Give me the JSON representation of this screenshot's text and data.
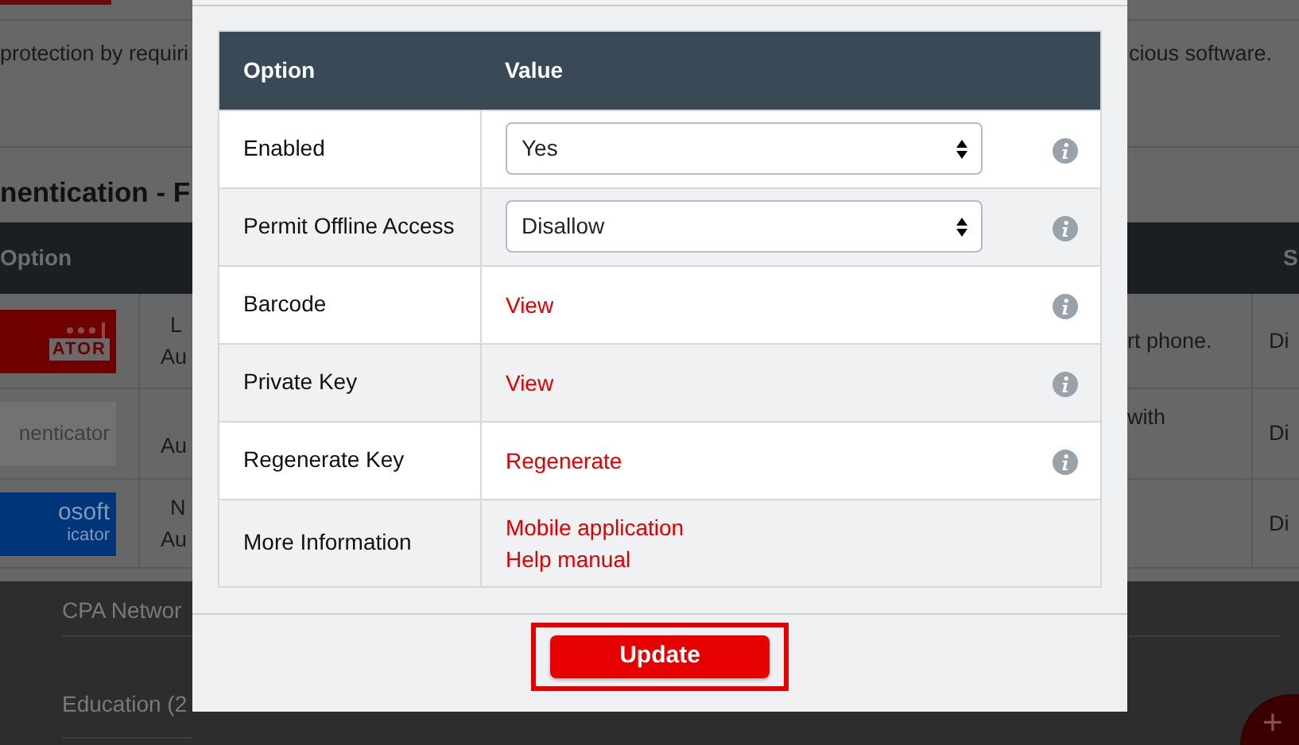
{
  "background": {
    "intro_left": "protection by requiri",
    "intro_right": "cious software.",
    "heading": "nentication - F",
    "table": {
      "columns": [
        "Option",
        "S"
      ],
      "rows": [
        {
          "color": "#6e0000",
          "logo_text": [
            "ATOR"
          ],
          "column_2": [
            "L",
            "Au"
          ],
          "column_4": [
            "rt phone."
          ],
          "column_5": "Di"
        },
        {
          "color": "#727272",
          "logo_text": [
            "nenticator"
          ],
          "column_2": [
            "Au"
          ],
          "column_4": [
            "with"
          ],
          "column_5": "Di"
        },
        {
          "color": "#00357a",
          "logo_text": [
            "osoft",
            "icator"
          ],
          "column_2": [
            "N",
            "Au"
          ],
          "column_4": [],
          "column_5": "Di"
        }
      ]
    },
    "categories": [
      "CPA Networ",
      "Education (2"
    ],
    "add_button": "+"
  },
  "modal": {
    "table": {
      "columns": [
        "Option",
        "Value"
      ],
      "rows": [
        {
          "option": "Enabled",
          "kind": "select",
          "value": "Yes",
          "info": true
        },
        {
          "option": "Permit Offline Access",
          "kind": "select",
          "value": "Disallow",
          "info": true
        },
        {
          "option": "Barcode",
          "kind": "links",
          "links": [
            "View"
          ],
          "info": true
        },
        {
          "option": "Private Key",
          "kind": "links",
          "links": [
            "View"
          ],
          "info": true
        },
        {
          "option": "Regenerate Key",
          "kind": "links",
          "links": [
            "Regenerate"
          ],
          "info": true
        },
        {
          "option": "More Information",
          "kind": "links",
          "links": [
            "Mobile application",
            "Help manual"
          ],
          "info": false
        }
      ]
    },
    "update_button": "Update"
  }
}
